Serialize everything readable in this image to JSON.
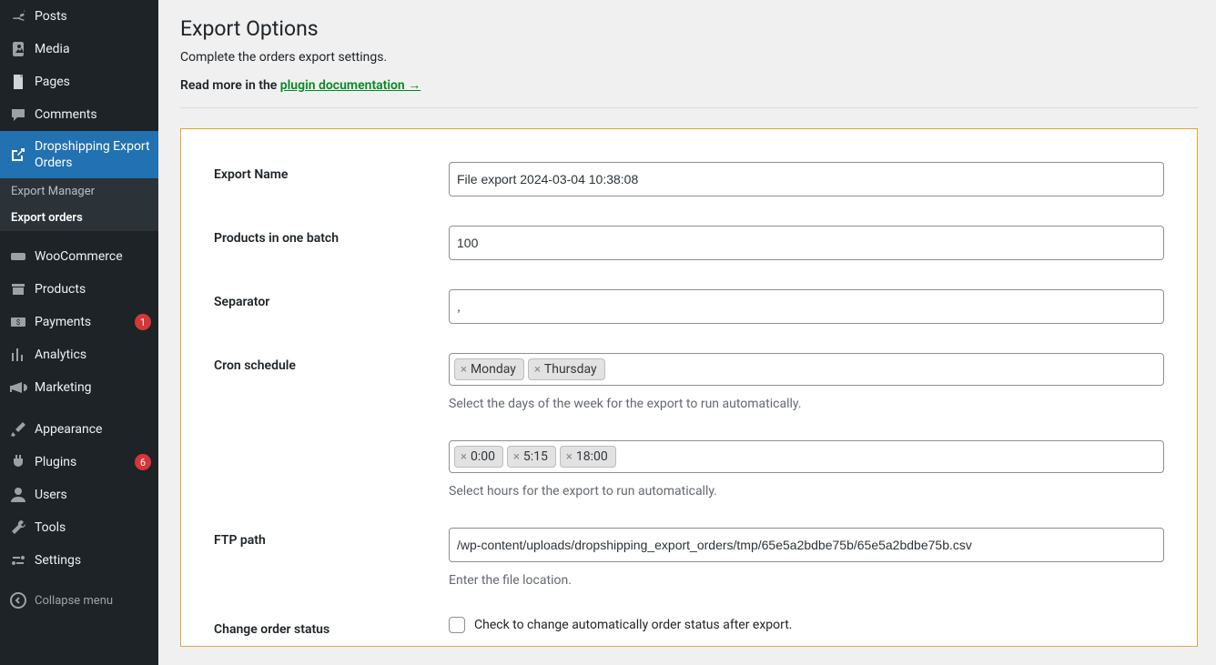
{
  "sidebar": {
    "items": [
      {
        "label": "Posts",
        "icon": "pin"
      },
      {
        "label": "Media",
        "icon": "media"
      },
      {
        "label": "Pages",
        "icon": "page"
      },
      {
        "label": "Comments",
        "icon": "comment"
      },
      {
        "label": "Dropshipping Export Orders",
        "icon": "export",
        "current": true
      },
      {
        "label": "WooCommerce",
        "icon": "woo"
      },
      {
        "label": "Products",
        "icon": "archive"
      },
      {
        "label": "Payments",
        "icon": "payments",
        "badge": "1"
      },
      {
        "label": "Analytics",
        "icon": "analytics"
      },
      {
        "label": "Marketing",
        "icon": "megaphone"
      },
      {
        "label": "Appearance",
        "icon": "brush"
      },
      {
        "label": "Plugins",
        "icon": "plugin",
        "badge": "6"
      },
      {
        "label": "Users",
        "icon": "user"
      },
      {
        "label": "Tools",
        "icon": "wrench"
      },
      {
        "label": "Settings",
        "icon": "settings"
      }
    ],
    "subitems": [
      {
        "label": "Export Manager"
      },
      {
        "label": "Export orders",
        "active": true
      }
    ],
    "collapse": "Collapse menu"
  },
  "main": {
    "title": "Export Options",
    "description": "Complete the orders export settings.",
    "read_more_prefix": "Read more in the ",
    "read_more_link": "plugin documentation →",
    "form": {
      "export_name": {
        "label": "Export Name",
        "value": "File export 2024-03-04 10:38:08"
      },
      "batch": {
        "label": "Products in one batch",
        "value": "100"
      },
      "separator": {
        "label": "Separator",
        "value": ","
      },
      "cron_days": {
        "label": "Cron schedule",
        "tokens": [
          "Monday",
          "Thursday"
        ],
        "help": "Select the days of the week for the export to run automatically."
      },
      "cron_hours": {
        "tokens": [
          "0:00",
          "5:15",
          "18:00"
        ],
        "help": "Select hours for the export to run automatically."
      },
      "ftp": {
        "label": "FTP path",
        "value": "/wp-content/uploads/dropshipping_export_orders/tmp/65e5a2bdbe75b/65e5a2bdbe75b.csv",
        "help": "Enter the file location."
      },
      "status": {
        "label": "Change order status",
        "checkbox_label": "Check to change automatically order status after export."
      }
    }
  }
}
